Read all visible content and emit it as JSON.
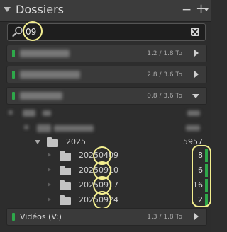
{
  "header": {
    "title": "Dossiers",
    "remove_label": "−",
    "add_label": "+"
  },
  "search": {
    "value": "09"
  },
  "volumes": [
    {
      "size": "1.2 / 1.8 To",
      "status_color": "#2ea84a"
    },
    {
      "size": "2.8 / 3.6 To",
      "status_color": "#2ea84a"
    },
    {
      "size": "0.8 / 3.6 To",
      "status_color": "#2ea84a"
    },
    {
      "name": "Vidéos (V:)",
      "size": "1.3 / 1.8 To",
      "status_color": "#2ea84a"
    }
  ],
  "tree": {
    "year": {
      "name": "2025",
      "count": "5957"
    },
    "folders": [
      {
        "name": "20250409",
        "count": "8"
      },
      {
        "name": "20250910",
        "count": "6"
      },
      {
        "name": "20250917",
        "count": "16"
      },
      {
        "name": "20250924",
        "count": "2"
      }
    ]
  },
  "colors": {
    "accent": "#2ea84a",
    "highlight": "#f3ee8f"
  }
}
